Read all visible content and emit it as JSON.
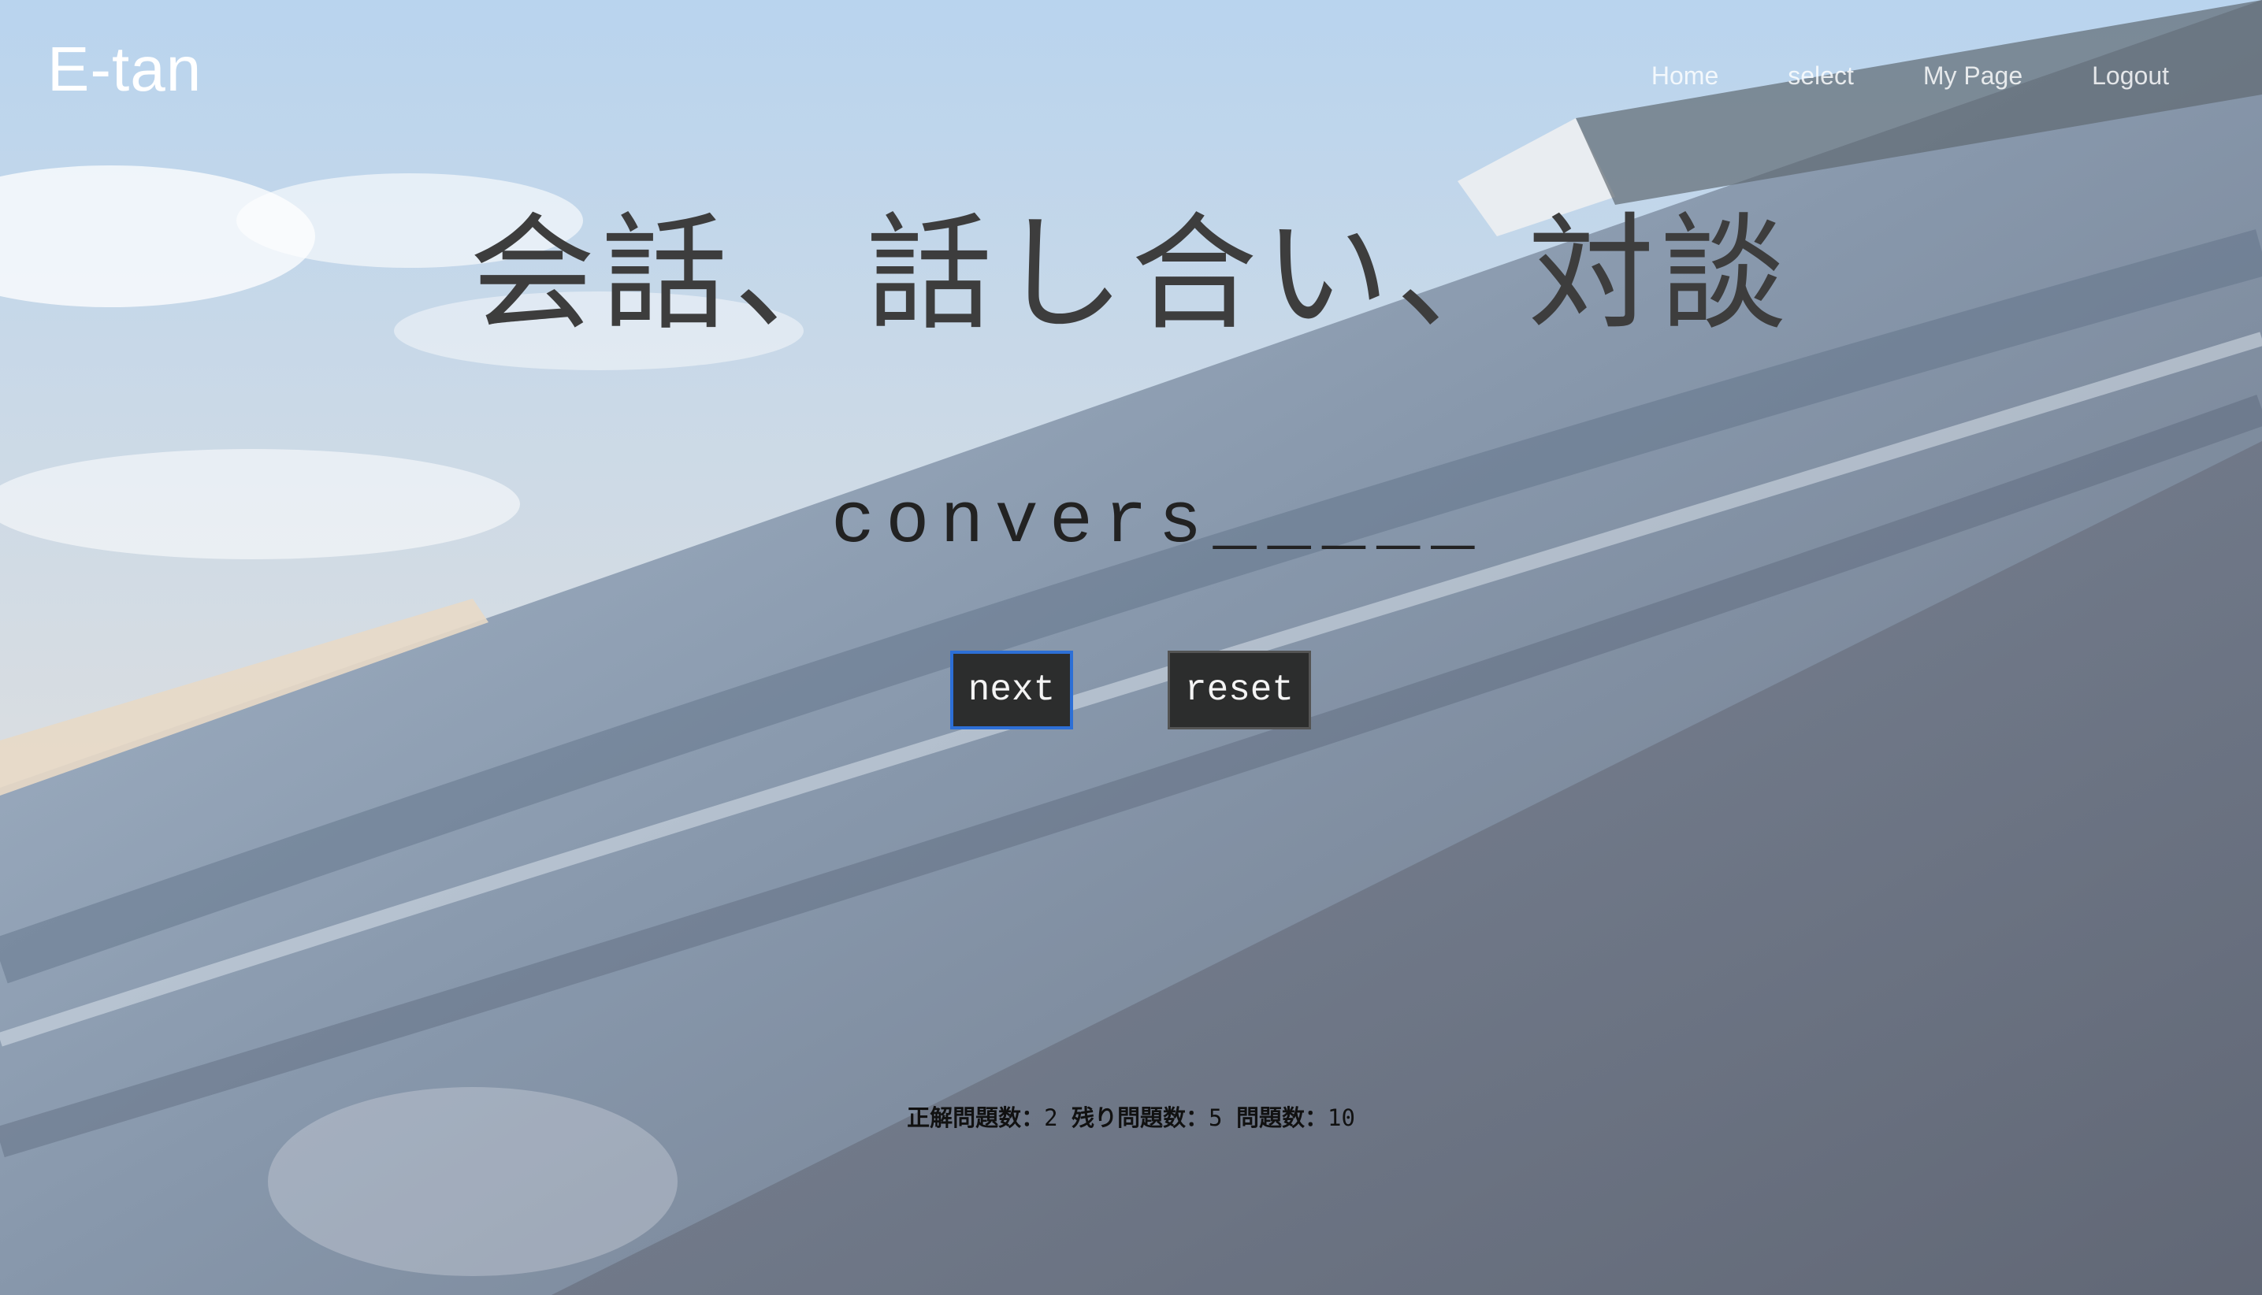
{
  "header": {
    "brand": "E-tan",
    "nav": {
      "home": "Home",
      "select": "select",
      "mypage": "My Page",
      "logout": "Logout"
    }
  },
  "quiz": {
    "question": "会話、話し合い、対談",
    "answer_display": "convers_____",
    "buttons": {
      "next": "next",
      "reset": "reset"
    },
    "stats": {
      "correct_label": "正解問題数：",
      "correct_value": "2",
      "remaining_label": "残り問題数：",
      "remaining_value": "5",
      "total_label": "問題数：",
      "total_value": "10"
    }
  },
  "colors": {
    "button_bg": "#2c2d2d",
    "focus_border": "#2d6fd6",
    "question_text": "#3d3d3d"
  }
}
